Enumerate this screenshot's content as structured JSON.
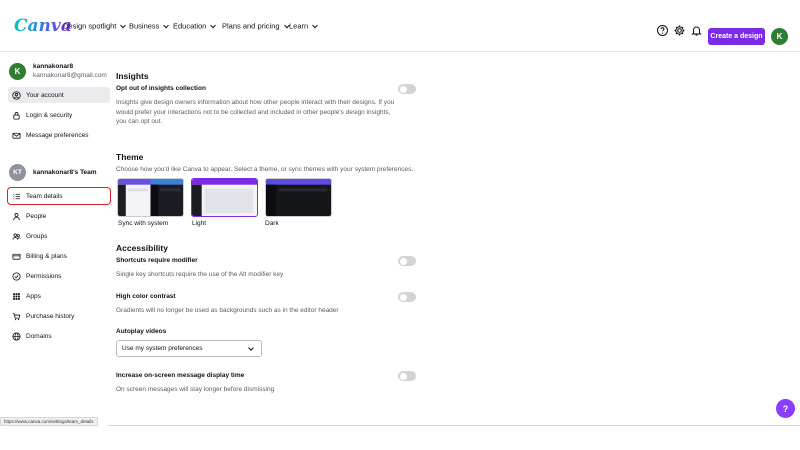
{
  "header": {
    "logo": "Canva",
    "nav": [
      "Design spotlight",
      "Business",
      "Education",
      "Plans and pricing",
      "Learn"
    ],
    "create_label": "Create a design",
    "avatar_initial": "K"
  },
  "sidebar": {
    "account": {
      "initial": "K",
      "name": "kannakonar8",
      "email": "kannakonar8@gmail.com"
    },
    "account_items": [
      {
        "label": "Your account",
        "icon": "user-circle-icon"
      },
      {
        "label": "Login & security",
        "icon": "lock-icon"
      },
      {
        "label": "Message preferences",
        "icon": "envelope-icon"
      }
    ],
    "team": {
      "initials": "KT",
      "name": "kannakonar8's Team"
    },
    "team_items": [
      {
        "label": "Team details",
        "icon": "list-icon"
      },
      {
        "label": "People",
        "icon": "person-icon"
      },
      {
        "label": "Groups",
        "icon": "people-icon"
      },
      {
        "label": "Billing & plans",
        "icon": "card-icon"
      },
      {
        "label": "Permissions",
        "icon": "check-circle-icon"
      },
      {
        "label": "Apps",
        "icon": "grid-icon"
      },
      {
        "label": "Purchase history",
        "icon": "cart-icon"
      },
      {
        "label": "Domains",
        "icon": "globe-icon"
      }
    ]
  },
  "insights": {
    "title": "Insights",
    "opt_out_label": "Opt out of insights collection",
    "desc_1": "Insights give design owners information about how other people interact with their designs. If you",
    "desc_2": "would prefer your interactions not to be collected and included in other people's design insights,",
    "desc_3": "you can opt out."
  },
  "theme": {
    "title": "Theme",
    "desc": "Choose how you'd like Canva to appear. Select a theme, or sync themes with your system preferences.",
    "options": [
      "Sync with system",
      "Light",
      "Dark"
    ],
    "selected": "Light"
  },
  "accessibility": {
    "title": "Accessibility",
    "shortcuts_label": "Shortcuts require modifier",
    "shortcuts_desc": "Single key shortcuts require the use of the Alt modifier key",
    "contrast_label": "High color contrast",
    "contrast_desc": "Gradients will no longer be used as backgrounds such as in the editor header",
    "autoplay_label": "Autoplay videos",
    "autoplay_value": "Use my system preferences",
    "display_time_label": "Increase on-screen message display time",
    "display_time_desc": "On screen messages will stay longer before dismissing"
  },
  "status_url": "https://www.canva.com/settings/team_details",
  "help_label": "?",
  "colors": {
    "brand_purple": "#7d2ae8",
    "avatar_green": "#2e7d32",
    "highlight_red": "#d9222a"
  }
}
